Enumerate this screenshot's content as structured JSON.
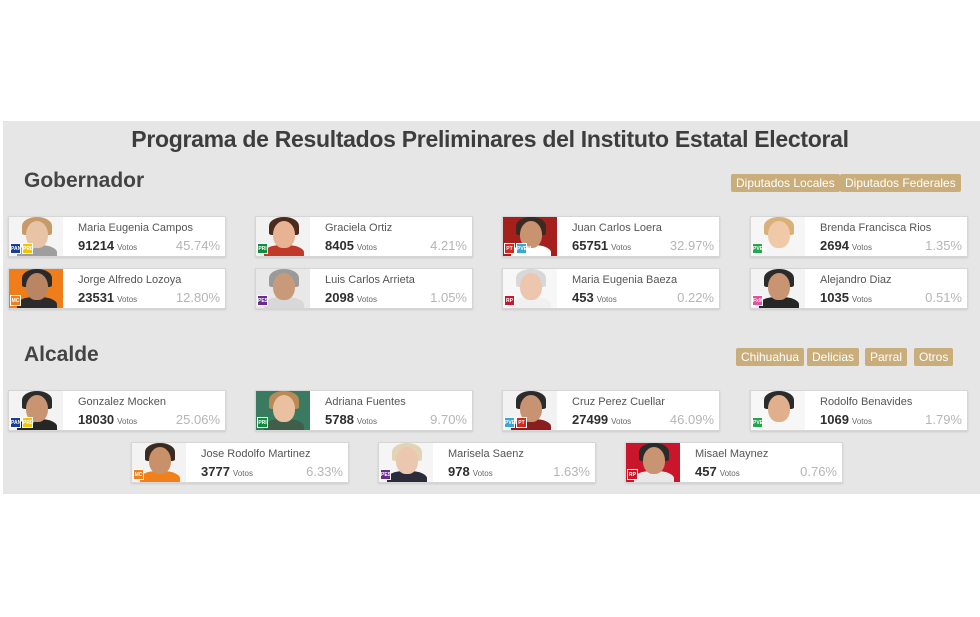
{
  "title": "Programa de Resultados Preliminares del Instituto Estatal Electoral",
  "gobernador": {
    "title": "Gobernador",
    "links": [
      "Diputados Locales",
      "Diputados Federales"
    ],
    "candidates": [
      {
        "name": "Maria Eugenia Campos",
        "votes": "91214",
        "votes_label": "Votos",
        "percent": "45.74%",
        "parties": [
          "PAN",
          "PRD"
        ],
        "party_colors": [
          "#1a3d9c",
          "#f2c500"
        ],
        "skin": "#e8c3a6",
        "hair": "#c89a6a",
        "clothes": "#9e9e9e",
        "bg": "#f4f4f4"
      },
      {
        "name": "Graciela Ortiz",
        "votes": "8405",
        "votes_label": "Votos",
        "percent": "4.21%",
        "parties": [
          "PRI"
        ],
        "party_colors": [
          "#0b8f3c"
        ],
        "skin": "#e7b392",
        "hair": "#4a2b1c",
        "clothes": "#c0392b",
        "bg": "#f2f2f2"
      },
      {
        "name": "Juan Carlos Loera",
        "votes": "65751",
        "votes_label": "Votos",
        "percent": "32.97%",
        "parties": [
          "PT",
          "PVEM"
        ],
        "party_colors": [
          "#d7261e",
          "#3aa6d8"
        ],
        "skin": "#c7946f",
        "hair": "#3a2a22",
        "clothes": "#ffffff",
        "bg": "#a5201c"
      },
      {
        "name": "Brenda Francisca Rios",
        "votes": "2694",
        "votes_label": "Votos",
        "percent": "1.35%",
        "parties": [
          "PVEM"
        ],
        "party_colors": [
          "#22a84a"
        ],
        "skin": "#f0c9a8",
        "hair": "#d9b079",
        "clothes": "#f5f5f5",
        "bg": "#f6f6f6"
      },
      {
        "name": "Jorge Alfredo Lozoya",
        "votes": "23531",
        "votes_label": "Votos",
        "percent": "12.80%",
        "parties": [
          "MC"
        ],
        "party_colors": [
          "#f08019"
        ],
        "skin": "#b98562",
        "hair": "#2a2a2a",
        "clothes": "#2b2b2b",
        "bg": "#ef7d1a"
      },
      {
        "name": "Luis Carlos Arrieta",
        "votes": "2098",
        "votes_label": "Votos",
        "percent": "1.05%",
        "parties": [
          "PES"
        ],
        "party_colors": [
          "#6a2a8f"
        ],
        "skin": "#c99a7a",
        "hair": "#9a9a9a",
        "clothes": "#d8d8d8",
        "bg": "#e8e8e8"
      },
      {
        "name": "Maria Eugenia Baeza",
        "votes": "453",
        "votes_label": "Votos",
        "percent": "0.22%",
        "parties": [
          "RP"
        ],
        "party_colors": [
          "#c9162b"
        ],
        "skin": "#ecc7ae",
        "hair": "#d8d8d8",
        "clothes": "#f0f0f0",
        "bg": "#f7f7f7"
      },
      {
        "name": "Alejandro Diaz",
        "votes": "1035",
        "votes_label": "Votos",
        "percent": "0.51%",
        "parties": [
          "FxM"
        ],
        "party_colors": [
          "#e0539d"
        ],
        "skin": "#c99472",
        "hair": "#2b2b2b",
        "clothes": "#262626",
        "bg": "#f3f3f3"
      }
    ]
  },
  "alcalde": {
    "title": "Alcalde",
    "links": [
      "Chihuahua",
      "Delicias",
      "Parral",
      "Otros"
    ],
    "candidates": [
      {
        "name": "Gonzalez Mocken",
        "votes": "18030",
        "votes_label": "Votos",
        "percent": "25.06%",
        "parties": [
          "PAN",
          "PRD"
        ],
        "party_colors": [
          "#1a3d9c",
          "#f2c500"
        ],
        "skin": "#c99472",
        "hair": "#2b2b2b",
        "clothes": "#262626",
        "bg": "#f3f3f3"
      },
      {
        "name": "Adriana Fuentes",
        "votes": "5788",
        "votes_label": "Votos",
        "percent": "9.70%",
        "parties": [
          "PRI"
        ],
        "party_colors": [
          "#0b8f3c"
        ],
        "skin": "#e9c0a0",
        "hair": "#b98a55",
        "clothes": "#3f5f4a",
        "bg": "#3a7a60"
      },
      {
        "name": "Cruz Perez Cuellar",
        "votes": "27499",
        "votes_label": "Votos",
        "percent": "46.09%",
        "parties": [
          "PVEM",
          "PT"
        ],
        "party_colors": [
          "#3aa6d8",
          "#d7261e"
        ],
        "skin": "#c79372",
        "hair": "#2b2b2b",
        "clothes": "#8a1d1d",
        "bg": "#f2f2f2"
      },
      {
        "name": "Rodolfo Benavides",
        "votes": "1069",
        "votes_label": "Votos",
        "percent": "1.79%",
        "parties": [
          "PVEM"
        ],
        "party_colors": [
          "#22a84a"
        ],
        "skin": "#e0b08d",
        "hair": "#2b2b2b",
        "clothes": "#f7f7f7",
        "bg": "#f7f7f7"
      },
      {
        "name": "Jose Rodolfo Martinez",
        "votes": "3777",
        "votes_label": "Votos",
        "percent": "6.33%",
        "parties": [
          "MC"
        ],
        "party_colors": [
          "#f08019"
        ],
        "skin": "#c8916a",
        "hair": "#3a2a1f",
        "clothes": "#f08019",
        "bg": "#f3f3f3"
      },
      {
        "name": "Marisela Saenz",
        "votes": "978",
        "votes_label": "Votos",
        "percent": "1.63%",
        "parties": [
          "PES"
        ],
        "party_colors": [
          "#6a2a8f"
        ],
        "skin": "#eac7ae",
        "hair": "#e3d3b5",
        "clothes": "#2b2b3a",
        "bg": "#f5f5f5"
      },
      {
        "name": "Misael Maynez",
        "votes": "457",
        "votes_label": "Votos",
        "percent": "0.76%",
        "parties": [
          "RP"
        ],
        "party_colors": [
          "#c9162b"
        ],
        "skin": "#c99472",
        "hair": "#2b2b2b",
        "clothes": "#e9e9e9",
        "bg": "#c9162b"
      }
    ]
  }
}
